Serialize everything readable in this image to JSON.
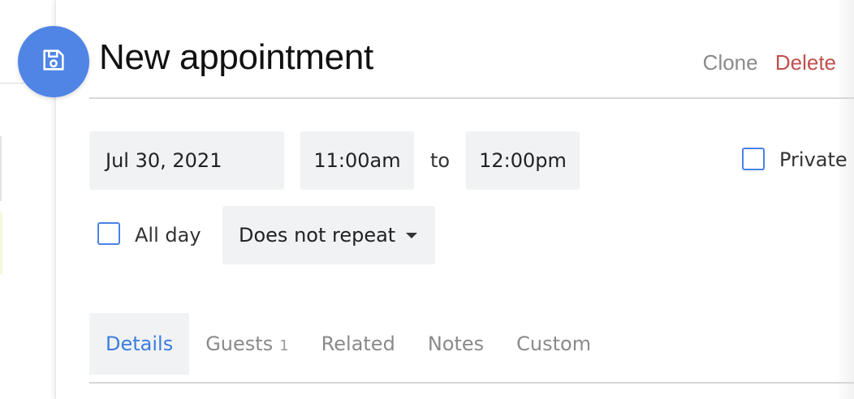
{
  "header": {
    "title": "New appointment",
    "clone_label": "Clone",
    "delete_label": "Delete"
  },
  "fields": {
    "date": "Jul 30, 2021",
    "start_time": "11:00am",
    "to_label": "to",
    "end_time": "12:00pm",
    "private_label": "Private",
    "private_checked": false,
    "all_day_label": "All day",
    "all_day_checked": false,
    "repeat_value": "Does not repeat"
  },
  "tabs": [
    {
      "label": "Details",
      "active": true
    },
    {
      "label": "Guests",
      "count": "1"
    },
    {
      "label": "Related"
    },
    {
      "label": "Notes"
    },
    {
      "label": "Custom"
    }
  ],
  "colors": {
    "accent": "#5085e6",
    "delete": "#c0504d",
    "active_tab_text": "#3b7de0",
    "field_bg": "#f1f2f4"
  },
  "icons": {
    "save": "floppy-disk-icon",
    "dropdown": "chevron-down-icon"
  }
}
